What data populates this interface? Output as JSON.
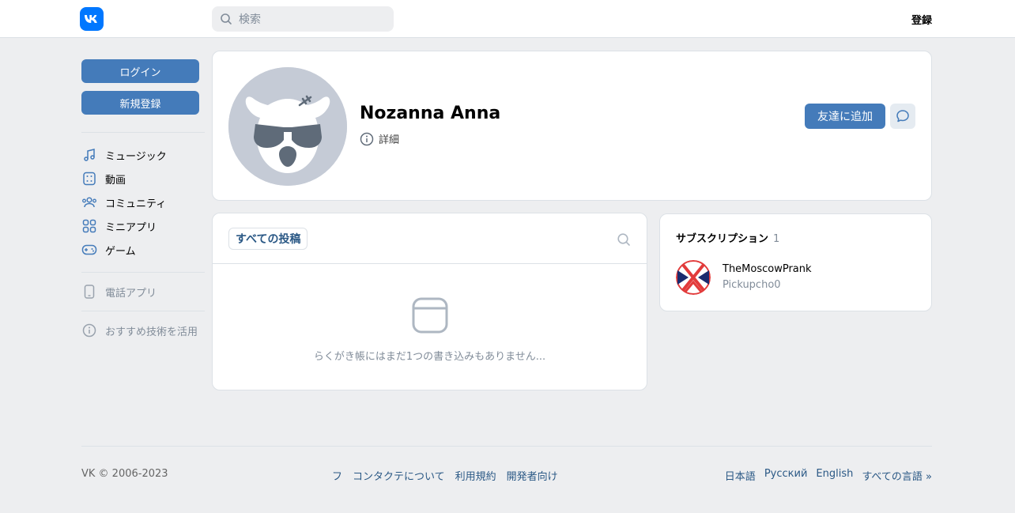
{
  "header": {
    "search_placeholder": "検索",
    "register": "登録"
  },
  "sidebar": {
    "login": "ログイン",
    "signup": "新規登録",
    "items": [
      {
        "label": "ミュージック",
        "icon": "music-icon"
      },
      {
        "label": "動画",
        "icon": "video-icon"
      },
      {
        "label": "コミュニティ",
        "icon": "community-icon"
      },
      {
        "label": "ミニアプリ",
        "icon": "apps-icon"
      },
      {
        "label": "ゲーム",
        "icon": "gamepad-icon"
      }
    ],
    "phone_app": "電話アプリ",
    "tech": "おすすめ技術を活用"
  },
  "profile": {
    "name": "Nozanna Anna",
    "details": "詳細",
    "add_friend": "友達に追加"
  },
  "wall": {
    "tab": "すべての投稿",
    "empty": "らくがき帳にはまだ1つの書き込みもありません..."
  },
  "subscriptions": {
    "title": "サブスクリプション",
    "count": "1",
    "item": {
      "name": "TheMoscowPrank",
      "sub": "Pickupcho0"
    }
  },
  "footer": {
    "copyright": "VK © 2006-2023",
    "links": [
      "フ",
      "コンタクテについて",
      "利用規約",
      "開発者向け"
    ],
    "langs": [
      "日本語",
      "Русский",
      "English",
      "すべての言語 »"
    ]
  },
  "colors": {
    "accent": "#447bba",
    "brand": "#0077ff",
    "link": "#2a5885",
    "bg": "#edeef0"
  }
}
